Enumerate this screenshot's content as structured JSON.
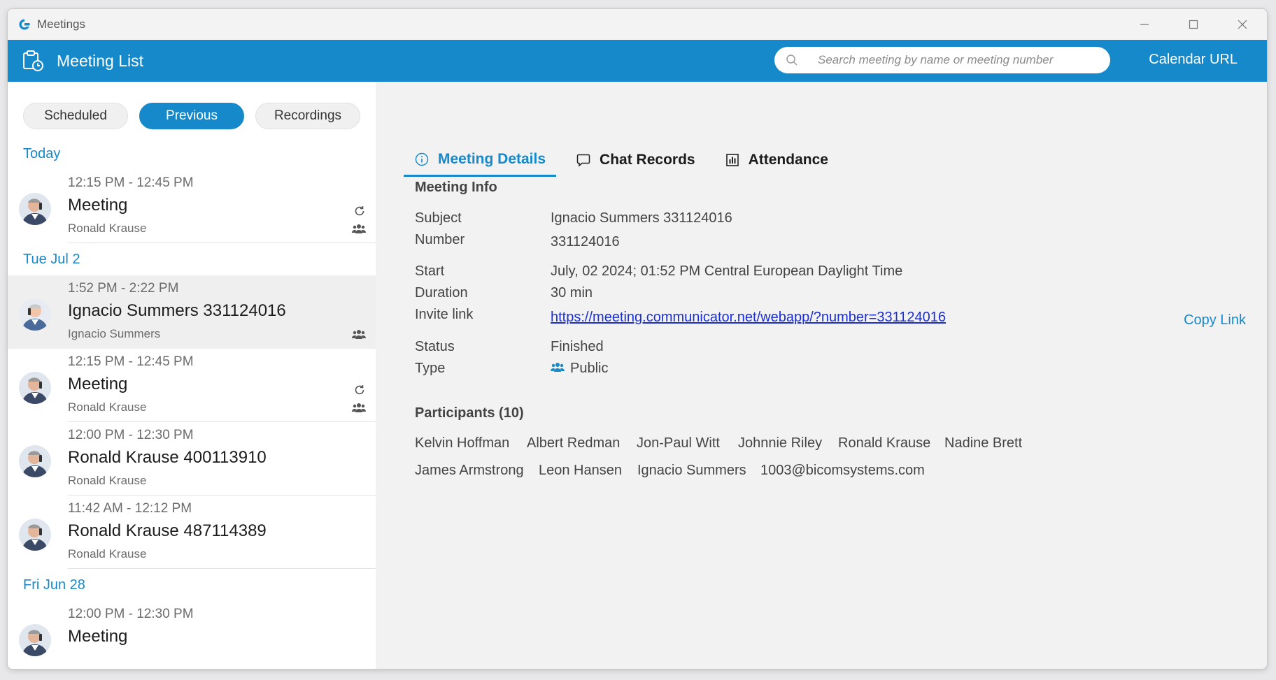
{
  "window": {
    "title": "Meetings",
    "accent": "#1689cb"
  },
  "appbar": {
    "title": "Meeting List",
    "search_placeholder": "Search meeting by name or meeting number",
    "calendar_url": "Calendar URL"
  },
  "filters": [
    {
      "label": "Scheduled",
      "active": false
    },
    {
      "label": "Previous",
      "active": true
    },
    {
      "label": "Recordings",
      "active": false
    }
  ],
  "groups": [
    {
      "date": "Today",
      "meetings": [
        {
          "time": "12:15 PM - 12:45 PM",
          "title": "Meeting",
          "host": "Ronald Krause",
          "recurring": true,
          "public": true
        }
      ]
    },
    {
      "date": "Tue Jul 2",
      "meetings": [
        {
          "time": "1:52 PM - 2:22 PM",
          "title": "Ignacio Summers 331124016",
          "host": "Ignacio Summers",
          "recurring": false,
          "public": true,
          "selected": true
        },
        {
          "time": "12:15 PM - 12:45 PM",
          "title": "Meeting",
          "host": "Ronald Krause",
          "recurring": true,
          "public": true
        },
        {
          "time": "12:00 PM - 12:30 PM",
          "title": "Ronald Krause 400113910",
          "host": "Ronald Krause",
          "recurring": false,
          "public": false
        },
        {
          "time": "11:42 AM - 12:12 PM",
          "title": "Ronald Krause 487114389",
          "host": "Ronald Krause",
          "recurring": false,
          "public": false
        }
      ]
    },
    {
      "date": "Fri Jun 28",
      "meetings": [
        {
          "time": "12:00 PM - 12:30 PM",
          "title": "Meeting",
          "host": "",
          "recurring": false,
          "public": false
        }
      ]
    }
  ],
  "tabs": [
    {
      "label": "Meeting Details",
      "icon": "info-icon",
      "active": true
    },
    {
      "label": "Chat Records",
      "icon": "chat-icon",
      "active": false
    },
    {
      "label": "Attendance",
      "icon": "attendance-icon",
      "active": false
    }
  ],
  "details": {
    "section_title": "Meeting Info",
    "subject_label": "Subject",
    "subject": "Ignacio Summers 331124016",
    "number_label": "Number",
    "number": "331124016",
    "start_label": "Start",
    "start": "July, 02 2024; 01:52 PM Central European Daylight Time",
    "duration_label": "Duration",
    "duration": "30 min",
    "invite_label": "Invite link",
    "invite_link": "https://meeting.communicator.net/webapp/?number=331124016",
    "copy_link": "Copy Link",
    "status_label": "Status",
    "status": "Finished",
    "type_label": "Type",
    "type": "Public"
  },
  "participants": {
    "title": "Participants (10)",
    "names": [
      "Kelvin Hoffman",
      "Albert Redman",
      "Jon-Paul Witt",
      "Johnnie Riley",
      "Ronald Krause",
      "Nadine Brett",
      "James Armstrong",
      "Leon Hansen",
      "Ignacio Summers",
      "1003@bicomsystems.com"
    ]
  }
}
